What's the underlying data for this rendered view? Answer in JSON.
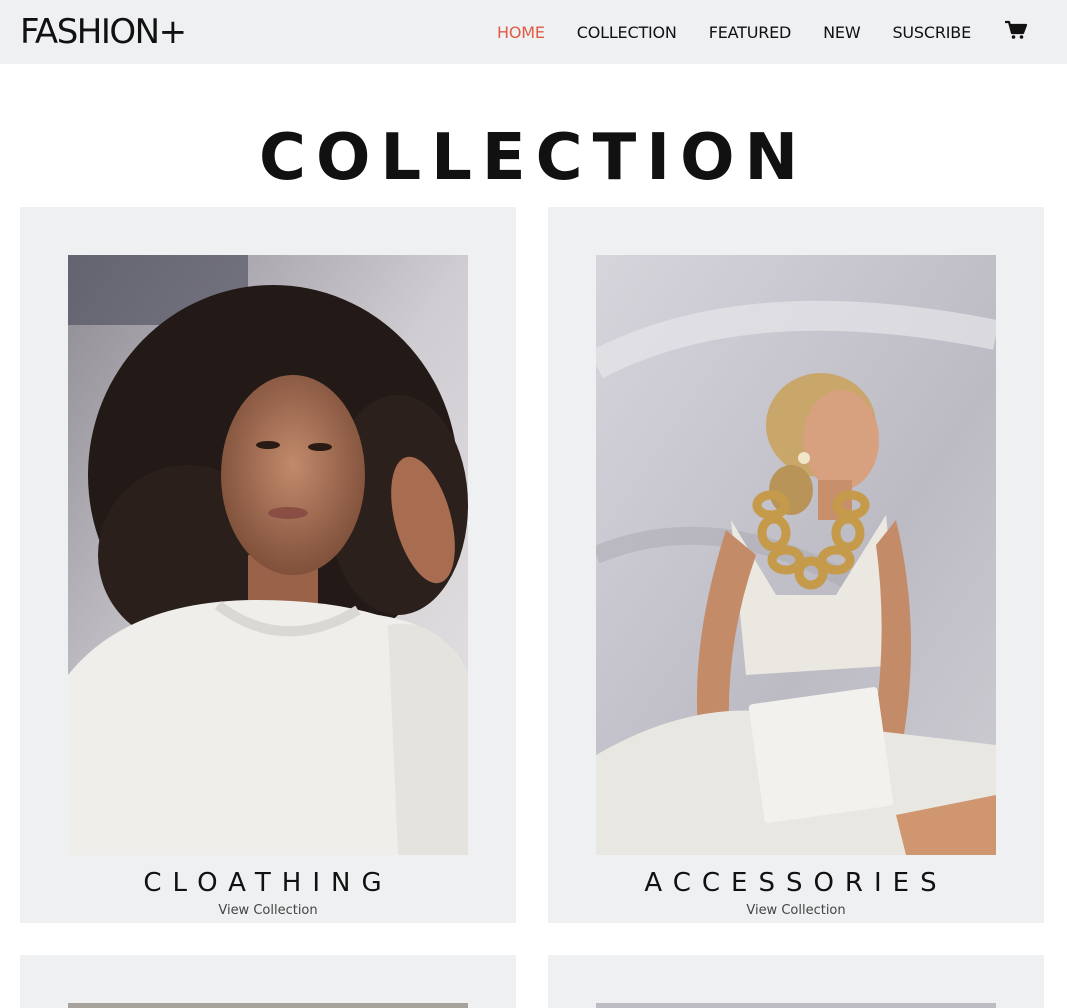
{
  "brand": {
    "logo": "FASHION+"
  },
  "nav": {
    "items": [
      {
        "label": "HOME",
        "active": true
      },
      {
        "label": "COLLECTION",
        "active": false
      },
      {
        "label": "FEATURED",
        "active": false
      },
      {
        "label": "NEW",
        "active": false
      },
      {
        "label": "SUSCRIBE",
        "active": false
      }
    ],
    "cart_icon": "cart-icon"
  },
  "section": {
    "title": "COLLECTION"
  },
  "cards": [
    {
      "title": "CLOATHING",
      "link": "View Collection",
      "image": "woman-curly-hair-white-sweater-photo"
    },
    {
      "title": "ACCESSORIES",
      "link": "View Collection",
      "image": "woman-gold-chain-necklace-photo"
    },
    {
      "title": "",
      "link": "",
      "image": "collection-photo"
    },
    {
      "title": "",
      "link": "",
      "image": "collection-photo"
    }
  ],
  "colors": {
    "nav_bg": "#eff0f2",
    "active": "#e05a45",
    "card_bg": "#eff0f2",
    "text": "#111111"
  }
}
